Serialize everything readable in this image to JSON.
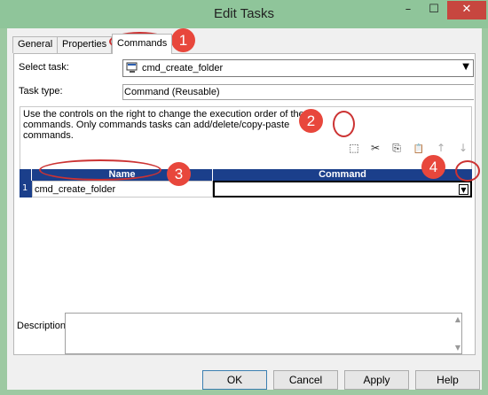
{
  "window": {
    "title": "Edit Tasks",
    "minimize_glyph": "–",
    "maximize_glyph": "☐",
    "close_glyph": "✕"
  },
  "tabs": [
    "General",
    "Properties",
    "Commands"
  ],
  "active_tab": "Commands",
  "form": {
    "select_task_label": "Select task:",
    "select_task_value": "cmd_create_folder",
    "task_type_label": "Task type:",
    "task_type_value": "Command (Reusable)"
  },
  "hint": "Use the controls on the right to change the execution order of the commands.  Only commands tasks can add/delete/copy-paste commands.",
  "toolbar": [
    {
      "name": "new-command-icon",
      "glyph": "⬚"
    },
    {
      "name": "cut-icon",
      "glyph": "✂"
    },
    {
      "name": "copy-icon",
      "glyph": "⎘"
    },
    {
      "name": "paste-icon",
      "glyph": "📋"
    },
    {
      "name": "move-up-icon",
      "glyph": "↑"
    },
    {
      "name": "move-down-icon",
      "glyph": "↓"
    }
  ],
  "grid": {
    "columns": [
      "Name",
      "Command"
    ],
    "rows": [
      {
        "num": "1",
        "name": "cmd_create_folder",
        "command": ""
      }
    ]
  },
  "description_label": "Description:",
  "buttons": {
    "ok": "OK",
    "cancel": "Cancel",
    "apply": "Apply",
    "help": "Help"
  },
  "callouts": [
    "1",
    "2",
    "3",
    "4"
  ],
  "colors": {
    "header_blue": "#1b3f8b",
    "callout_red": "#e8473c",
    "titlebar_green": "#8fc59a"
  }
}
